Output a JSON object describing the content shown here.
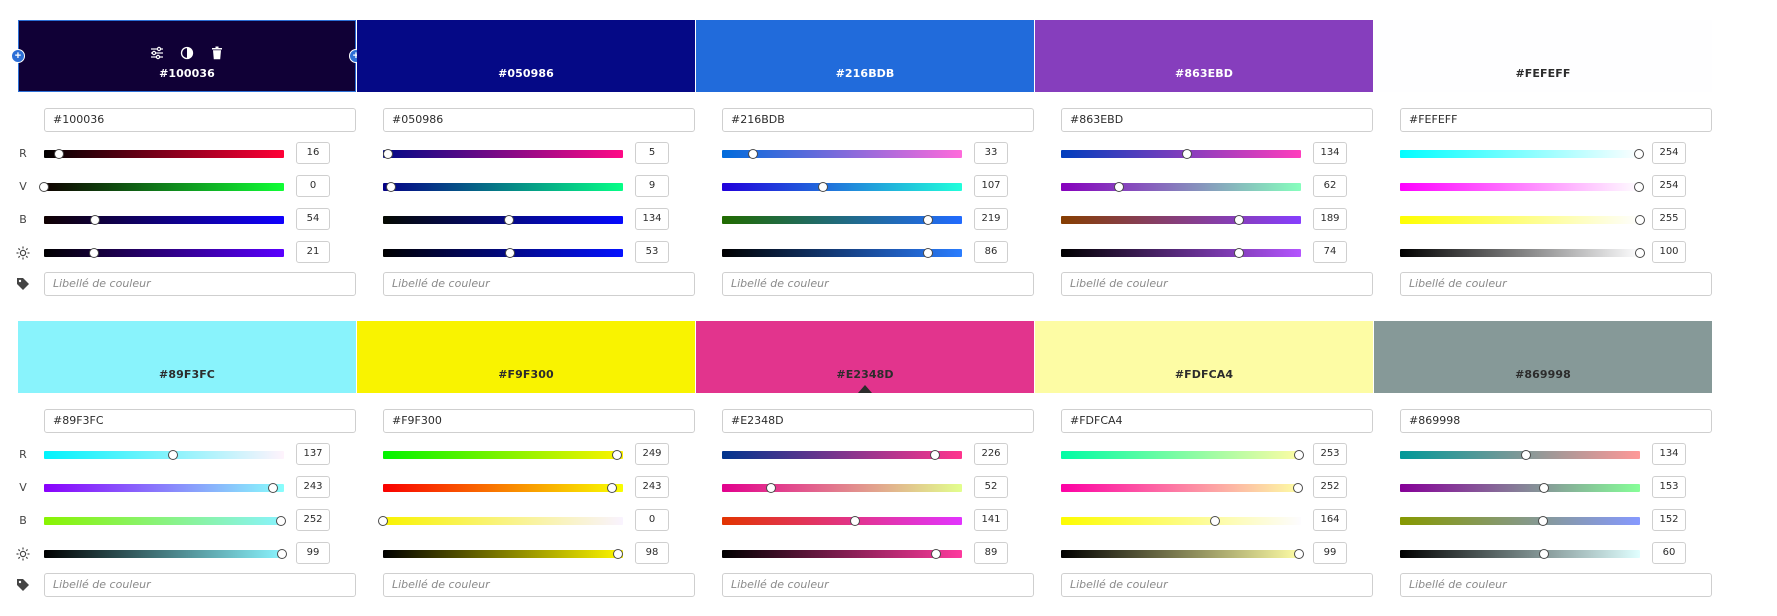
{
  "row_labels": [
    "R",
    "V",
    "B"
  ],
  "row_icons": [
    "brightness-icon",
    "tag-icon"
  ],
  "label_placeholder": "Libellé de couleur",
  "swatches": [
    {
      "hex": "#100036",
      "color": "#100036",
      "text": "#ffffff",
      "r": 16,
      "g": 0,
      "b": 54,
      "bright": 21,
      "rG": [
        "#000000",
        "#ff0036"
      ],
      "gG": [
        "#100000",
        "#10ff36"
      ],
      "bG": [
        "#100000",
        "#1000ff"
      ],
      "lG": [
        "#000000",
        "#5a00ff"
      ]
    },
    {
      "hex": "#050986",
      "color": "#050986",
      "text": "#ffffff",
      "r": 5,
      "g": 9,
      "b": 134,
      "bright": 53,
      "rG": [
        "#000986",
        "#ff0986"
      ],
      "gG": [
        "#050086",
        "#05ff86"
      ],
      "bG": [
        "#050900",
        "#0509ff"
      ],
      "lG": [
        "#000000",
        "#0512ff"
      ]
    },
    {
      "hex": "#216BDB",
      "color": "#216BDB",
      "text": "#ffffff",
      "r": 33,
      "g": 107,
      "b": 219,
      "bright": 86,
      "rG": [
        "#006bdb",
        "#ff6bdb"
      ],
      "gG": [
        "#2100db",
        "#21ffdb"
      ],
      "bG": [
        "#216b00",
        "#216bff"
      ],
      "lG": [
        "#000000",
        "#2a7dff"
      ]
    },
    {
      "hex": "#863EBD",
      "color": "#863EBD",
      "text": "#ffffff",
      "r": 134,
      "g": 62,
      "b": 189,
      "bright": 74,
      "rG": [
        "#003ebd",
        "#ff3ebd"
      ],
      "gG": [
        "#8600bd",
        "#86ffbd"
      ],
      "bG": [
        "#863e00",
        "#863eff"
      ],
      "lG": [
        "#000000",
        "#b455ff"
      ]
    },
    {
      "hex": "#FEFEFF",
      "color": "#FEFEFF",
      "text": "#2c2c2c",
      "r": 254,
      "g": 254,
      "b": 255,
      "bright": 100,
      "rG": [
        "#00feff",
        "#fefeff"
      ],
      "gG": [
        "#fe00ff",
        "#fefeff"
      ],
      "bG": [
        "#fefe00",
        "#fefeff"
      ],
      "lG": [
        "#000000",
        "#fefeff"
      ]
    },
    {
      "hex": "#89F3FC",
      "color": "#89F3FC",
      "text": "#2c2c2c",
      "r": 137,
      "g": 243,
      "b": 252,
      "bright": 99,
      "rG": [
        "#00f3fc",
        "#fff3fc"
      ],
      "gG": [
        "#8900fc",
        "#89fffc"
      ],
      "bG": [
        "#89f300",
        "#89f3ff"
      ],
      "lG": [
        "#000000",
        "#8bf5ff"
      ]
    },
    {
      "hex": "#F9F300",
      "color": "#F9F300",
      "text": "#2c2c2c",
      "r": 249,
      "g": 243,
      "b": 0,
      "bright": 98,
      "rG": [
        "#00f300",
        "#fff300"
      ],
      "gG": [
        "#f90000",
        "#f9ff00"
      ],
      "bG": [
        "#f9f300",
        "#f9f3ff"
      ],
      "lG": [
        "#000000",
        "#fff800"
      ]
    },
    {
      "hex": "#E2348D",
      "color": "#E2348D",
      "text": "#2c2c2c",
      "r": 226,
      "g": 52,
      "b": 141,
      "bright": 89,
      "rG": [
        "#00348d",
        "#ff348d"
      ],
      "gG": [
        "#e2008d",
        "#e2ff8d"
      ],
      "bG": [
        "#e23400",
        "#e234ff"
      ],
      "lG": [
        "#000000",
        "#fe3a9e"
      ]
    },
    {
      "hex": "#FDFCA4",
      "color": "#FDFCA4",
      "text": "#2c2c2c",
      "r": 253,
      "g": 252,
      "b": 164,
      "bright": 99,
      "rG": [
        "#00fca4",
        "#fffca4"
      ],
      "gG": [
        "#fd00a4",
        "#fdffa4"
      ],
      "bG": [
        "#fdfc00",
        "#fdfcff"
      ],
      "lG": [
        "#000000",
        "#fffea6"
      ]
    },
    {
      "hex": "#869998",
      "color": "#869998",
      "text": "#2c2c2c",
      "r": 134,
      "g": 153,
      "b": 152,
      "bright": 60,
      "rG": [
        "#009998",
        "#ff9998"
      ],
      "gG": [
        "#860098",
        "#86ff98"
      ],
      "bG": [
        "#869900",
        "#8699ff"
      ],
      "lG": [
        "#000000",
        "#e0ffff"
      ]
    }
  ],
  "selected_index": 0,
  "pointer_index": 7,
  "accent": "#2c6fd6"
}
